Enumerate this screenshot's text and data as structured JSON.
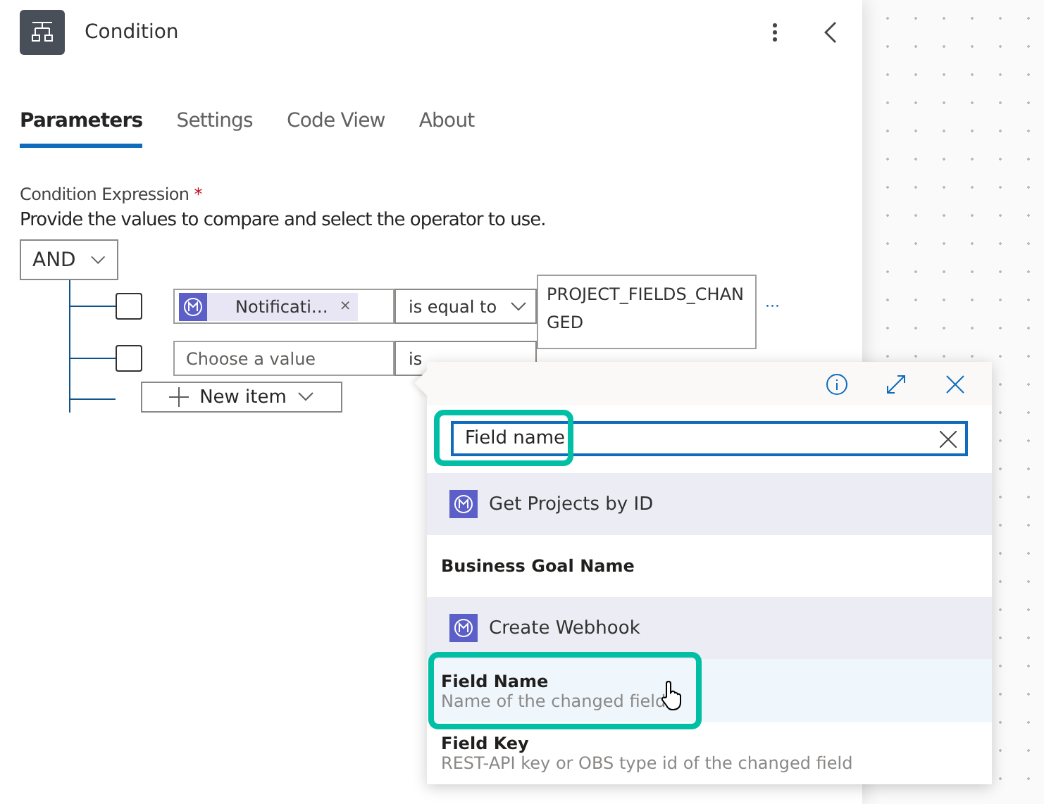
{
  "panel": {
    "title": "Condition"
  },
  "tabs": [
    {
      "label": "Parameters",
      "selected": true
    },
    {
      "label": "Settings",
      "selected": false
    },
    {
      "label": "Code View",
      "selected": false
    },
    {
      "label": "About",
      "selected": false
    }
  ],
  "condition": {
    "label": "Condition Expression",
    "required_mark": "*",
    "description": "Provide the values to compare and select the operator to use.",
    "group_operator": "AND",
    "rows": [
      {
        "checked": false,
        "value": {
          "kind": "token",
          "text": "Notificati…",
          "remove": "×"
        },
        "operator": "is equal to",
        "value2": "PROJECT_FIELDS_CHANGED",
        "more": "···"
      },
      {
        "checked": false,
        "value": {
          "kind": "placeholder",
          "text": "Choose a value"
        },
        "operator": "is"
      }
    ],
    "new_item": "New item"
  },
  "picker": {
    "search": "Field name",
    "groups": [
      {
        "title": "Get Projects by ID",
        "items": [
          {
            "name": "Business Goal Name",
            "hovered": false
          }
        ]
      },
      {
        "title": "Create Webhook",
        "items": [
          {
            "name": "Field Name",
            "description": "Name of the changed field",
            "hovered": true
          },
          {
            "name": "Field Key",
            "description": "REST-API key or OBS type id of the changed field",
            "hovered": false
          }
        ]
      }
    ]
  }
}
